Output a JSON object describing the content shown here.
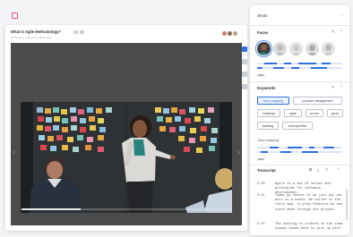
{
  "app": {
    "logo_icon": "app-logo-icon"
  },
  "window": {
    "title": "What is Agile Methodology?",
    "subtitle": "All Projects / Sessions / Recording",
    "more_icon": "more-vertical-icon"
  },
  "player": {
    "progress_fraction": 0.28,
    "prev_icon": "chevron-left-icon",
    "next_icon": "chevron-right-icon"
  },
  "toolbar": {
    "icons": [
      "pen-icon",
      "tag-icon",
      "text-icon",
      "share-icon"
    ]
  },
  "panel": {
    "title": "Shots",
    "faces": {
      "title": "Faces",
      "edit_icon": "edit-icon",
      "toggle_icon": "chevron-up-icon"
    },
    "keywords": {
      "title": "Keywords",
      "edit_icon": "edit-icon",
      "toggle_icon": "chevron-up-icon",
      "chips": [
        "story mapping",
        "product management",
        "roadmap",
        "agile",
        "scrum",
        "sprint",
        "backlog",
        "retrospective"
      ],
      "active": "story mapping",
      "selected_label": "\"story mapping\""
    },
    "transcript": {
      "title": "Transcript",
      "icons": [
        "copy-icon",
        "download-icon",
        "edit-icon",
        "chevron-up-icon"
      ],
      "rows": [
        {
          "time": "0:08",
          "text": "Agile is a set of values and principles for software development."
        },
        {
          "time": "0:11",
          "text": "Teams go faster if we just put our work on a board. We called it the story map, to plan features by how users move through the product."
        },
        {
          "time": "0:15",
          "text": "The backlog is ordered so the team always knows what to pick up next."
        }
      ]
    },
    "accent_color": "#2f6fde"
  }
}
